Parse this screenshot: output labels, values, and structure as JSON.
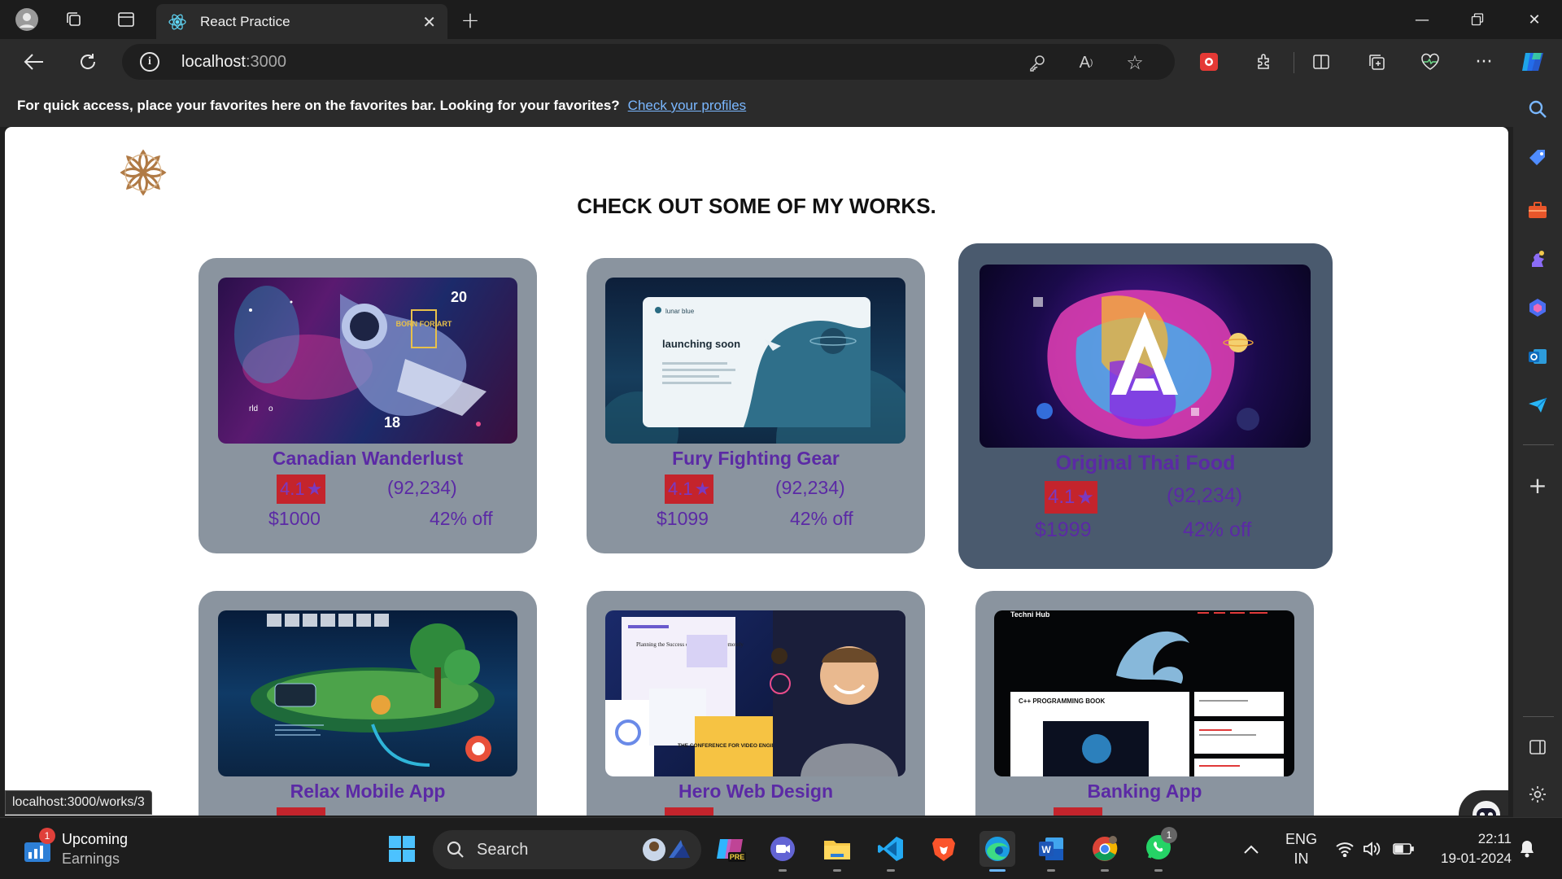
{
  "browser": {
    "tab_title": "React Practice",
    "url_host": "localhost",
    "url_port": ":3000",
    "favorites_message": "For quick access, place your favorites here on the favorites bar. Looking for your favorites?",
    "favorites_link": "Check your profiles",
    "status_url": "localhost:3000/works/3"
  },
  "page": {
    "heading": "CHECK OUT SOME OF MY WORKS.",
    "cards": [
      {
        "title": "Canadian Wanderlust",
        "rating": "4.1",
        "reviews": "(92,234)",
        "price": "$1000",
        "discount": "42% off"
      },
      {
        "title": "Fury Fighting Gear",
        "rating": "4.1",
        "reviews": "(92,234)",
        "price": "$1099",
        "discount": "42% off"
      },
      {
        "title": "Original Thai Food",
        "rating": "4.1",
        "reviews": "(92,234)",
        "price": "$1999",
        "discount": "42% off"
      },
      {
        "title": "Relax Mobile App"
      },
      {
        "title": "Hero Web Design"
      },
      {
        "title": "Banking App"
      }
    ],
    "thumb_text": {
      "lunar_brand": "lunar blue",
      "launching": "launching soon",
      "planning": "Planning the Success of the Working Remotely",
      "conference": "THE CONFERENCE FOR VIDEO ENGINEERS",
      "techni_hub": "Techni Hub",
      "cpp_book": "C++ PROGRAMMING BOOK",
      "poster_20": "20",
      "poster_18": "18",
      "poster_born": "BORN FOR ART",
      "poster_rld": "rld",
      "poster_o": "o"
    }
  },
  "taskbar": {
    "widget_title": "Upcoming",
    "widget_sub": "Earnings",
    "widget_badge": "1",
    "search_label": "Search",
    "whatsapp_badge": "1",
    "lang_top": "ENG",
    "lang_bottom": "IN",
    "time": "22:11",
    "date": "19-01-2024",
    "copilot_pre": "PRE"
  },
  "colors": {
    "card_bg": "#8a949f",
    "card_hover_bg": "#4a5a6e",
    "title_purple": "#5b2aa5",
    "rating_red": "#c4242c"
  }
}
